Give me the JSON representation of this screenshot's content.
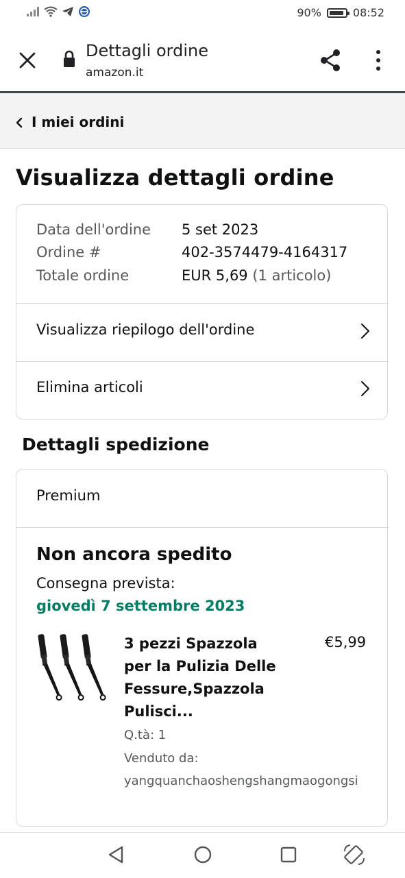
{
  "status_bar": {
    "battery": "90%",
    "battery_level": 0.9,
    "time": "08:52",
    "icons": [
      "signal-icon",
      "wifi-icon",
      "telegram-icon",
      "browser-icon"
    ]
  },
  "browser": {
    "title": "Dettagli ordine",
    "host": "amazon.it",
    "icons": [
      "close-icon",
      "lock-icon",
      "share-icon",
      "more-vert-icon"
    ]
  },
  "breadcrumb": {
    "label": "I miei ordini"
  },
  "page_title": "Visualizza dettagli ordine",
  "order_info": {
    "date_label": "Data dell'ordine",
    "date_value": "5 set 2023",
    "number_label": "Ordine #",
    "number_value": "402-3574479-4164317",
    "total_label": "Totale ordine",
    "total_value": "EUR 5,69",
    "total_items": "(1 articolo)"
  },
  "order_actions": [
    {
      "label": "Visualizza riepilogo dell'ordine"
    },
    {
      "label": "Elimina articoli"
    }
  ],
  "shipping": {
    "section_title": "Dettagli spedizione",
    "service": "Premium",
    "status": "Non ancora spedito",
    "delivery_label": "Consegna prevista:",
    "delivery_date": "giovedì 7 settembre 2023",
    "item": {
      "title": "3 pezzi Spazzola per la Pulizia Delle Fessure,Spazzola Pulisci...",
      "price": "€5,99",
      "qty": "Q.tà: 1",
      "sold_by_label": "Venduto da:",
      "seller": "yangquanchaoshengshangmaogongsi"
    }
  },
  "colors": {
    "delivery_green": "#067d62",
    "card_border": "#d5d9d9",
    "crumb_background": "#f3f3f3"
  }
}
